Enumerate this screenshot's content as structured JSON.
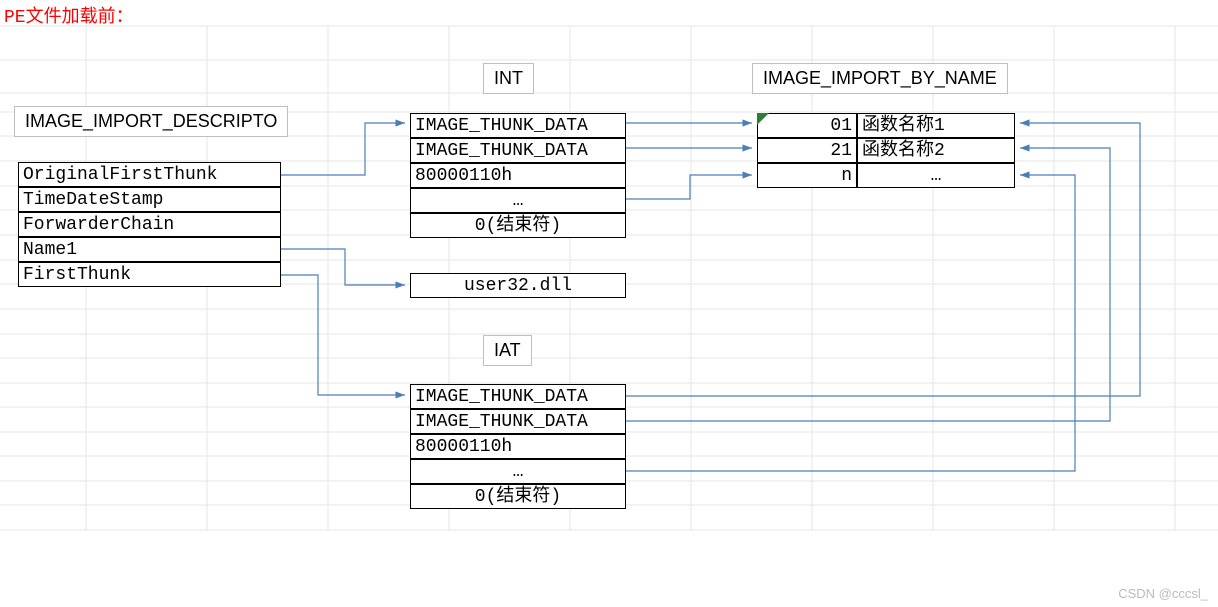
{
  "title": "PE文件加载前：",
  "labels": {
    "descriptor": "IMAGE_IMPORT_DESCRIPTO",
    "int": "INT",
    "iat": "IAT",
    "import_by_name": "IMAGE_IMPORT_BY_NAME"
  },
  "descriptor": {
    "rows": [
      "OriginalFirstThunk",
      "TimeDateStamp",
      "ForwarderChain",
      "Name1",
      "FirstThunk"
    ]
  },
  "int_table": {
    "rows": [
      "IMAGE_THUNK_DATA",
      "IMAGE_THUNK_DATA",
      "80000110h",
      "…",
      "0(结束符)"
    ]
  },
  "dll": "user32.dll",
  "iat_table": {
    "rows": [
      "IMAGE_THUNK_DATA",
      "IMAGE_THUNK_DATA",
      "80000110h",
      "…",
      "0(结束符)"
    ]
  },
  "import_by_name": {
    "rows": [
      {
        "idx": "01",
        "name": "函数名称1"
      },
      {
        "idx": "21",
        "name": "函数名称2"
      },
      {
        "idx": "n",
        "name": "…"
      }
    ]
  },
  "watermark": "CSDN @cccsl_"
}
